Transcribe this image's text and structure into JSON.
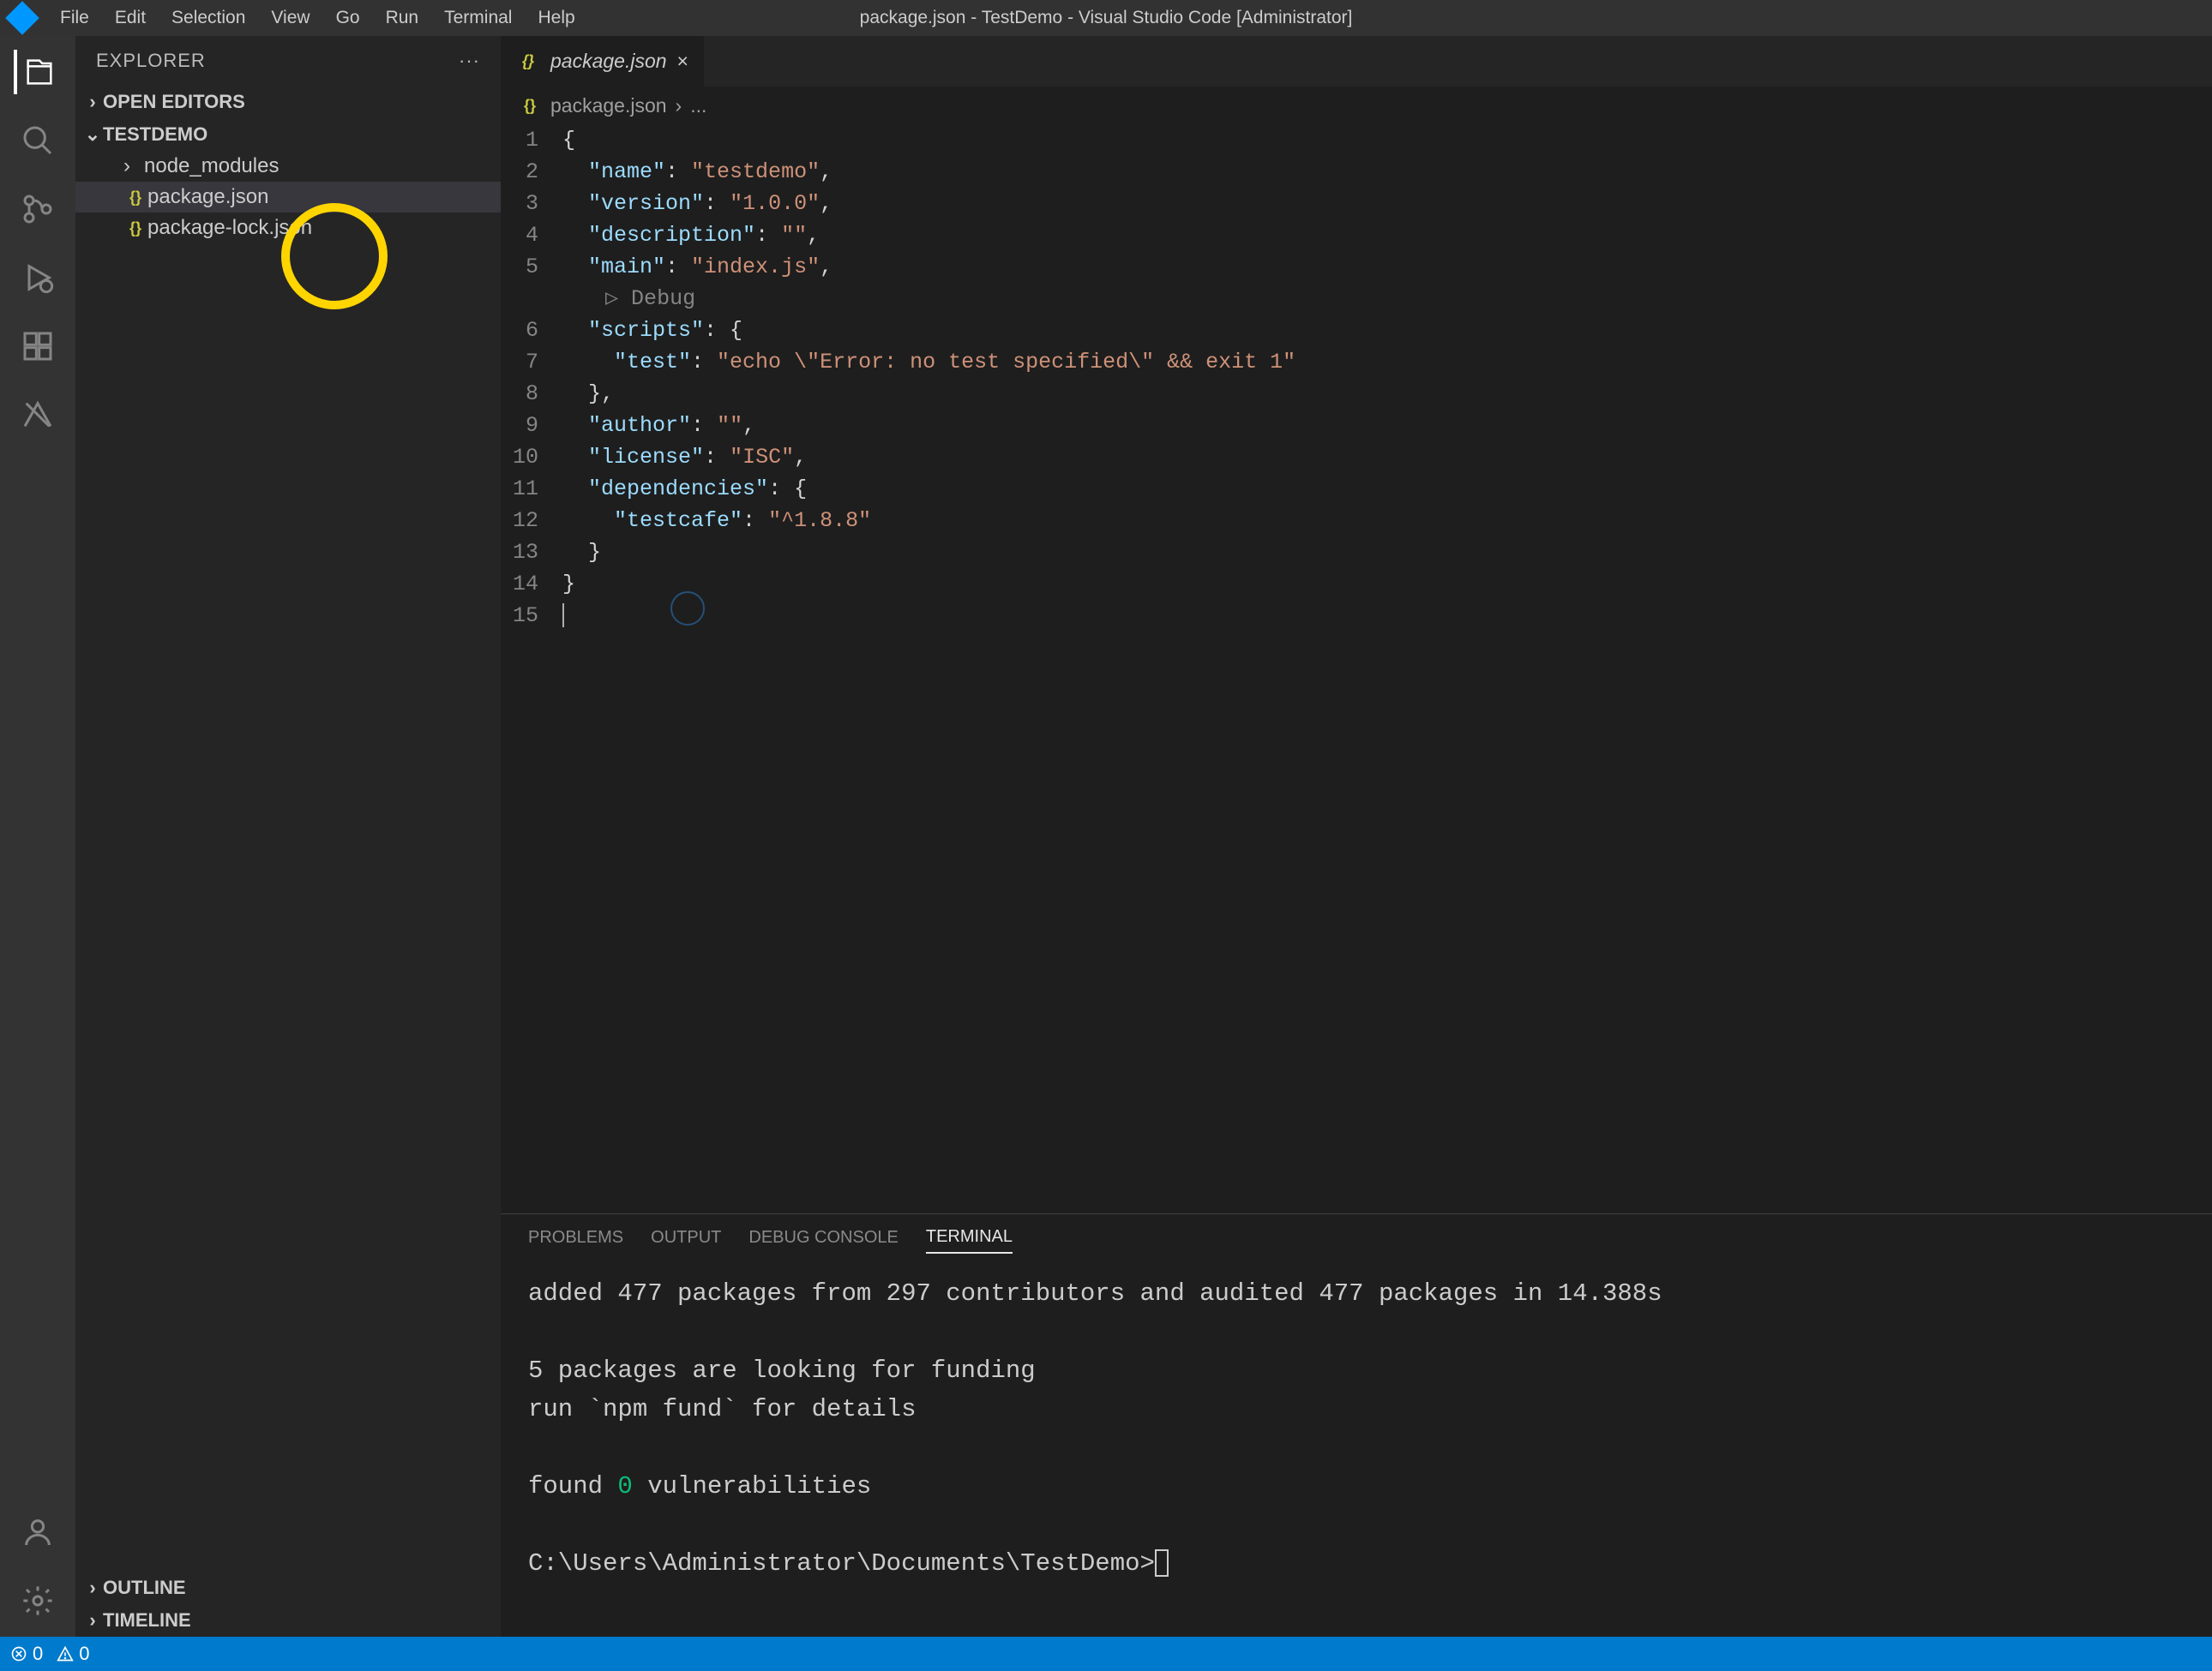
{
  "window_title": "package.json - TestDemo - Visual Studio Code [Administrator]",
  "menu": {
    "items": [
      "File",
      "Edit",
      "Selection",
      "View",
      "Go",
      "Run",
      "Terminal",
      "Help"
    ]
  },
  "sidebar": {
    "title": "EXPLORER",
    "open_editors": "OPEN EDITORS",
    "project_name": "TESTDEMO",
    "tree": [
      {
        "label": "node_modules",
        "type": "folder"
      },
      {
        "label": "package.json",
        "type": "json",
        "selected": true
      },
      {
        "label": "package-lock.json",
        "type": "json"
      }
    ],
    "outline": "OUTLINE",
    "timeline": "TIMELINE"
  },
  "tab": {
    "icon_label": "{}",
    "label": "package.json"
  },
  "breadcrumb": {
    "icon": "{}",
    "file": "package.json",
    "sep": "›",
    "more": "..."
  },
  "editor": {
    "debug_label": "Debug",
    "lines": [
      {
        "num": "1",
        "tokens": [
          {
            "t": "punct",
            "v": "{"
          }
        ]
      },
      {
        "num": "2",
        "tokens": [
          {
            "t": "pad",
            "v": "  "
          },
          {
            "t": "key",
            "v": "\"name\""
          },
          {
            "t": "punct",
            "v": ": "
          },
          {
            "t": "string",
            "v": "\"testdemo\""
          },
          {
            "t": "punct",
            "v": ","
          }
        ]
      },
      {
        "num": "3",
        "tokens": [
          {
            "t": "pad",
            "v": "  "
          },
          {
            "t": "key",
            "v": "\"version\""
          },
          {
            "t": "punct",
            "v": ": "
          },
          {
            "t": "string",
            "v": "\"1.0.0\""
          },
          {
            "t": "punct",
            "v": ","
          }
        ]
      },
      {
        "num": "4",
        "tokens": [
          {
            "t": "pad",
            "v": "  "
          },
          {
            "t": "key",
            "v": "\"description\""
          },
          {
            "t": "punct",
            "v": ": "
          },
          {
            "t": "string",
            "v": "\"\""
          },
          {
            "t": "punct",
            "v": ","
          }
        ]
      },
      {
        "num": "5",
        "tokens": [
          {
            "t": "pad",
            "v": "  "
          },
          {
            "t": "key",
            "v": "\"main\""
          },
          {
            "t": "punct",
            "v": ": "
          },
          {
            "t": "string",
            "v": "\"index.js\""
          },
          {
            "t": "punct",
            "v": ","
          }
        ]
      },
      {
        "num": "6",
        "tokens": [
          {
            "t": "pad",
            "v": "  "
          },
          {
            "t": "key",
            "v": "\"scripts\""
          },
          {
            "t": "punct",
            "v": ": {"
          }
        ]
      },
      {
        "num": "7",
        "tokens": [
          {
            "t": "pad",
            "v": "    "
          },
          {
            "t": "key",
            "v": "\"test\""
          },
          {
            "t": "punct",
            "v": ": "
          },
          {
            "t": "string",
            "v": "\"echo \\\"Error: no test specified\\\" && exit 1\""
          }
        ]
      },
      {
        "num": "8",
        "tokens": [
          {
            "t": "pad",
            "v": "  "
          },
          {
            "t": "punct",
            "v": "},"
          }
        ]
      },
      {
        "num": "9",
        "tokens": [
          {
            "t": "pad",
            "v": "  "
          },
          {
            "t": "key",
            "v": "\"author\""
          },
          {
            "t": "punct",
            "v": ": "
          },
          {
            "t": "string",
            "v": "\"\""
          },
          {
            "t": "punct",
            "v": ","
          }
        ]
      },
      {
        "num": "10",
        "tokens": [
          {
            "t": "pad",
            "v": "  "
          },
          {
            "t": "key",
            "v": "\"license\""
          },
          {
            "t": "punct",
            "v": ": "
          },
          {
            "t": "string",
            "v": "\"ISC\""
          },
          {
            "t": "punct",
            "v": ","
          }
        ]
      },
      {
        "num": "11",
        "tokens": [
          {
            "t": "pad",
            "v": "  "
          },
          {
            "t": "key",
            "v": "\"dependencies\""
          },
          {
            "t": "punct",
            "v": ": {"
          }
        ]
      },
      {
        "num": "12",
        "tokens": [
          {
            "t": "pad",
            "v": "    "
          },
          {
            "t": "key",
            "v": "\"testcafe\""
          },
          {
            "t": "punct",
            "v": ": "
          },
          {
            "t": "string",
            "v": "\"^1.8.8\""
          }
        ]
      },
      {
        "num": "13",
        "tokens": [
          {
            "t": "pad",
            "v": "  "
          },
          {
            "t": "punct",
            "v": "}"
          }
        ]
      },
      {
        "num": "14",
        "tokens": [
          {
            "t": "punct",
            "v": "}"
          }
        ]
      },
      {
        "num": "15",
        "tokens": []
      }
    ]
  },
  "panel": {
    "tabs": [
      "PROBLEMS",
      "OUTPUT",
      "DEBUG CONSOLE",
      "TERMINAL"
    ],
    "active": "TERMINAL"
  },
  "terminal": {
    "line1": "added 477 packages from 297 contributors and audited 477 packages in 14.388s",
    "line2": "5 packages are looking for funding",
    "line3": "  run `npm fund` for details",
    "line4_a": "found ",
    "line4_b": "0",
    "line4_c": " vulnerabilities",
    "prompt": "C:\\Users\\Administrator\\Documents\\TestDemo>"
  },
  "status": {
    "errors": "0",
    "warnings": "0"
  }
}
